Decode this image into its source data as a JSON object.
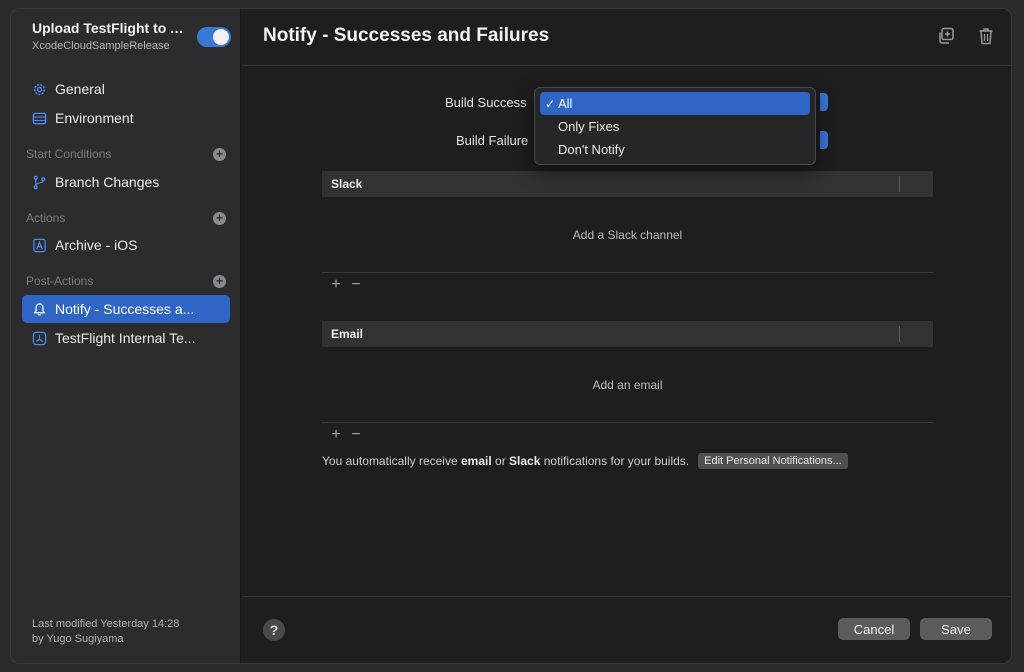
{
  "workflow": {
    "title": "Upload TestFlight to A...",
    "subtitle": "XcodeCloudSampleRelease",
    "enabled": true
  },
  "sidebar": {
    "items": [
      {
        "label": "General",
        "icon": "gear-icon"
      },
      {
        "label": "Environment",
        "icon": "environment-icon"
      }
    ],
    "sections": {
      "start_conditions": {
        "title": "Start Conditions",
        "items": [
          {
            "label": "Branch Changes",
            "icon": "branch-icon"
          }
        ]
      },
      "actions": {
        "title": "Actions",
        "items": [
          {
            "label": "Archive - iOS",
            "icon": "archive-icon"
          }
        ]
      },
      "post_actions": {
        "title": "Post-Actions",
        "items": [
          {
            "label": "Notify - Successes a...",
            "icon": "bell-icon",
            "selected": true
          },
          {
            "label": "TestFlight Internal Te...",
            "icon": "testflight-icon"
          }
        ]
      }
    },
    "modified_line1": "Last modified Yesterday 14:28",
    "modified_line2": "by Yugo Sugiyama"
  },
  "main": {
    "title": "Notify - Successes and Failures",
    "build_success_label": "Build Success",
    "build_failure_label": "Build Failure",
    "slack": {
      "header": "Slack",
      "empty": "Add a Slack channel"
    },
    "email": {
      "header": "Email",
      "empty": "Add an email"
    },
    "footnote": {
      "part1": "You automatically receive",
      "email": "email",
      "or": "or",
      "slack": "Slack",
      "part2": "notifications for your builds."
    },
    "edit_button": "Edit Personal Notifications..."
  },
  "dropdown": {
    "options": [
      "All",
      "Only Fixes",
      "Don't Notify"
    ],
    "selected": "All",
    "check": "✓"
  },
  "footer": {
    "help": "?",
    "cancel": "Cancel",
    "save": "Save"
  },
  "colors": {
    "accent": "#2f65c4",
    "toggle": "#3a78d8",
    "background": "#1e1e20",
    "sidebar": "#2c2c2e"
  }
}
